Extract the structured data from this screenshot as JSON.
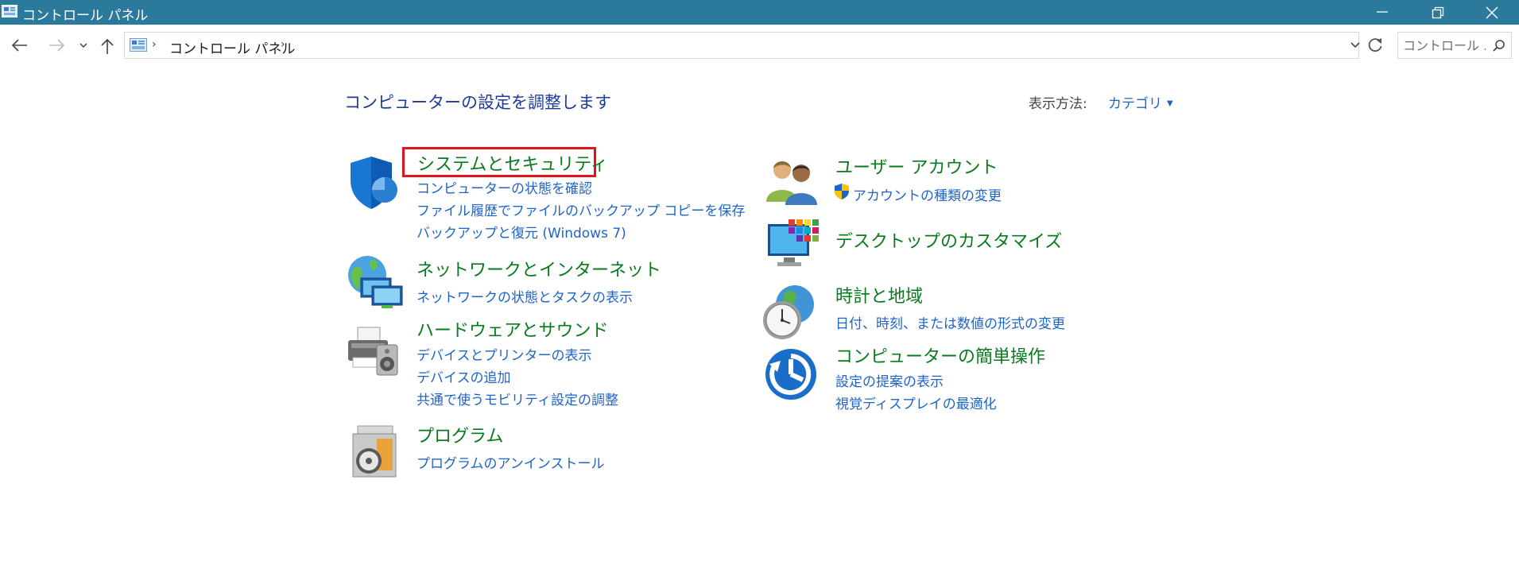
{
  "window": {
    "title": "コントロール パネル"
  },
  "addressbar": {
    "breadcrumb": "コントロール パネル",
    "search_placeholder": "コントロール ..."
  },
  "main": {
    "heading": "コンピューターの設定を調整します",
    "view_by_label": "表示方法:",
    "view_by_value": "カテゴリ"
  },
  "categories": {
    "system_security": {
      "title": "システムとセキュリティ",
      "links": [
        "コンピューターの状態を確認",
        "ファイル履歴でファイルのバックアップ コピーを保存",
        "バックアップと復元 (Windows 7)"
      ]
    },
    "network": {
      "title": "ネットワークとインターネット",
      "links": [
        "ネットワークの状態とタスクの表示"
      ]
    },
    "hardware": {
      "title": "ハードウェアとサウンド",
      "links": [
        "デバイスとプリンターの表示",
        "デバイスの追加",
        "共通で使うモビリティ設定の調整"
      ]
    },
    "programs": {
      "title": "プログラム",
      "links": [
        "プログラムのアンインストール"
      ]
    },
    "user_accounts": {
      "title": "ユーザー アカウント",
      "links": [
        "アカウントの種類の変更"
      ]
    },
    "appearance": {
      "title": "デスクトップのカスタマイズ",
      "links": []
    },
    "clock_region": {
      "title": "時計と地域",
      "links": [
        "日付、時刻、または数値の形式の変更"
      ]
    },
    "ease_of_access": {
      "title": "コンピューターの簡単操作",
      "links": [
        "設定の提案の表示",
        "視覚ディスプレイの最適化"
      ]
    }
  },
  "colors": {
    "titlebar": "#2b7a9b",
    "category_title": "#0a7a1e",
    "link": "#1e64c8",
    "heading": "#1e3c96",
    "highlight_box": "#e0141e"
  }
}
